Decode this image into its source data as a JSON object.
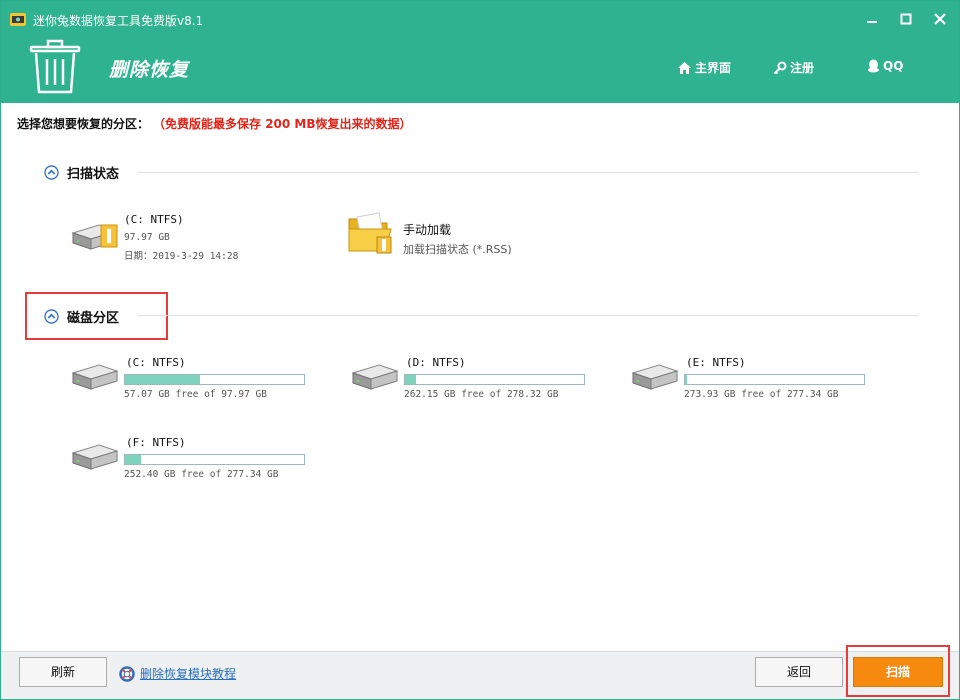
{
  "window": {
    "title": "迷你兔数据恢复工具免费版v8.1"
  },
  "header": {
    "heading": "删除恢复",
    "nav": {
      "home": "主界面",
      "register": "注册",
      "qq": "QQ"
    }
  },
  "prompt": {
    "label": "选择您想要恢复的分区：",
    "note": "（免费版能最多保存 200 MB恢复出来的数据）"
  },
  "scan_status": {
    "title": "扫描状态",
    "items": [
      {
        "name": "(C: NTFS)",
        "size": "97.97 GB",
        "date": "日期：2019-3-29 14:28"
      },
      {
        "name": "手动加载",
        "desc": "加载扫描状态 (*.RSS)"
      }
    ]
  },
  "disk_partitions": {
    "title": "磁盘分区",
    "items": [
      {
        "name": "(C: NTFS)",
        "free_text": "57.07 GB free of 97.97 GB",
        "used_fraction": 0.42
      },
      {
        "name": "(D: NTFS)",
        "free_text": "262.15 GB free of 278.32 GB",
        "used_fraction": 0.06
      },
      {
        "name": "(E: NTFS)",
        "free_text": "273.93 GB free of 277.34 GB",
        "used_fraction": 0.012
      },
      {
        "name": "(F: NTFS)",
        "free_text": "252.40 GB free of 277.34 GB",
        "used_fraction": 0.09
      }
    ]
  },
  "footer": {
    "refresh": "刷新",
    "tutorial": "删除恢复模块教程",
    "back": "返回",
    "scan": "扫描"
  },
  "colors": {
    "header": "#2fb28f",
    "bar_fill": "#7fd3bd",
    "scan_button": "#f58a0f",
    "highlight": "#e23c3c",
    "note": "#e0261b"
  },
  "icons": {
    "app": "app-logo-icon",
    "trash": "trash-can-icon",
    "home": "home-icon",
    "key": "key-icon",
    "qq": "qq-penguin-icon",
    "drive": "hard-drive-icon",
    "folder": "folder-icon",
    "collapse": "chevron-up-circle-icon",
    "help": "lifebuoy-icon"
  }
}
